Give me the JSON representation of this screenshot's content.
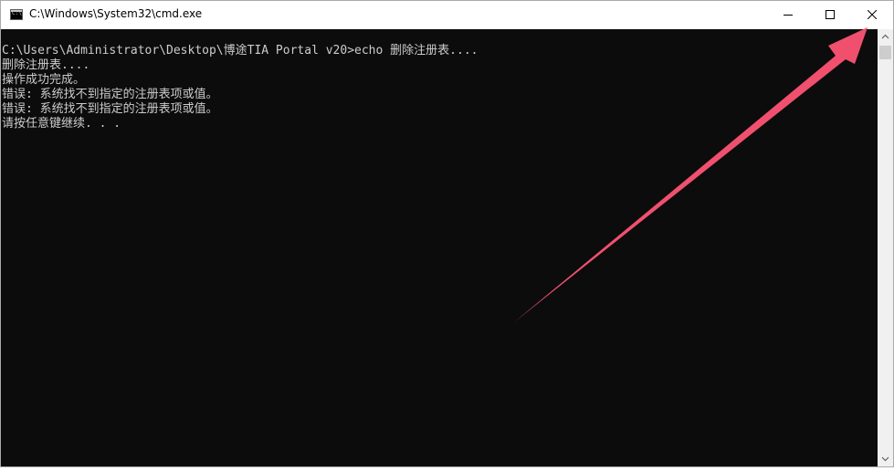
{
  "window": {
    "title": "C:\\Windows\\System32\\cmd.exe",
    "icon_label": "C:\\"
  },
  "controls": {
    "minimize_icon": "minimize-icon",
    "maximize_icon": "maximize-icon",
    "close_icon": "close-icon"
  },
  "console": {
    "lines": [
      "C:\\Users\\Administrator\\Desktop\\博途TIA Portal v20>echo 删除注册表....",
      "删除注册表....",
      "操作成功完成。",
      "错误: 系统找不到指定的注册表项或值。",
      "错误: 系统找不到指定的注册表项或值。",
      "请按任意键继续. . ."
    ]
  },
  "annotation": {
    "arrow_color": "#f0506e",
    "arrow_target": "close-button"
  },
  "colors": {
    "console_bg": "#0c0c0c",
    "console_text": "#cccccc",
    "titlebar_bg": "#ffffff"
  }
}
